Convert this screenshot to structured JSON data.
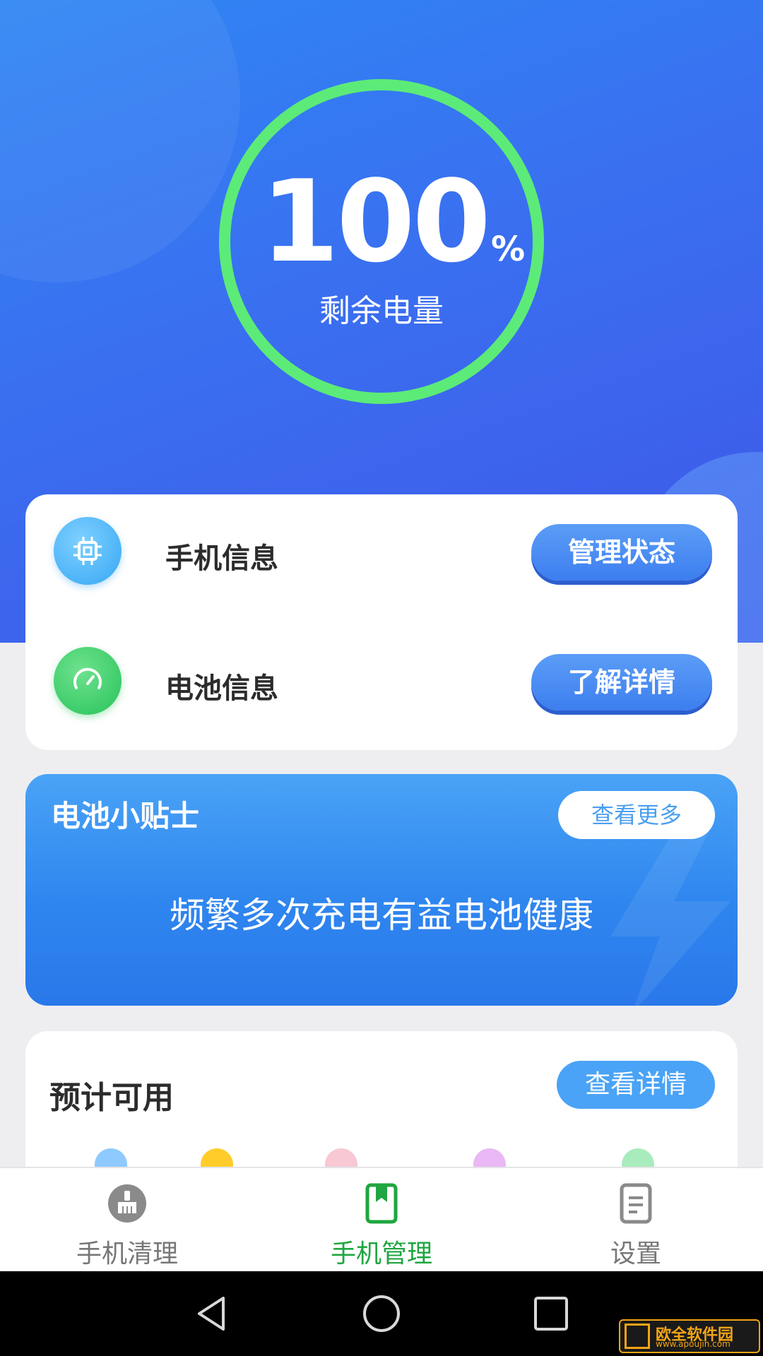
{
  "battery": {
    "percent_value": "100",
    "percent_sign": "%",
    "label": "剩余电量",
    "level": 1.0
  },
  "info_card": {
    "rows": [
      {
        "title": "手机信息",
        "button": "管理状态",
        "icon": "chip-icon"
      },
      {
        "title": "电池信息",
        "button": "了解详情",
        "icon": "gauge-icon"
      }
    ]
  },
  "tips": {
    "title": "电池小贴士",
    "more": "查看更多",
    "text": "频繁多次充电有益电池健康"
  },
  "usage": {
    "title": "预计可用",
    "detail": "查看详情",
    "dot_colors": [
      "#8ec9ff",
      "#ffcc2a",
      "#f8c8d4",
      "#eab8f4",
      "#a8ecbe"
    ]
  },
  "tabbar": {
    "tabs": [
      {
        "label": "手机清理",
        "icon": "broom-icon"
      },
      {
        "label": "手机管理",
        "icon": "phone-manage-icon",
        "active": true
      },
      {
        "label": "设置",
        "icon": "settings-doc-icon"
      }
    ]
  },
  "watermark": {
    "cn": "欧全软件园",
    "en": "www.apoujin.com"
  },
  "colors": {
    "hero": "#3a6ff0",
    "ring": "#5ceb78",
    "accent_blue": "#4aa3f6",
    "active_tab": "#1fa640"
  }
}
